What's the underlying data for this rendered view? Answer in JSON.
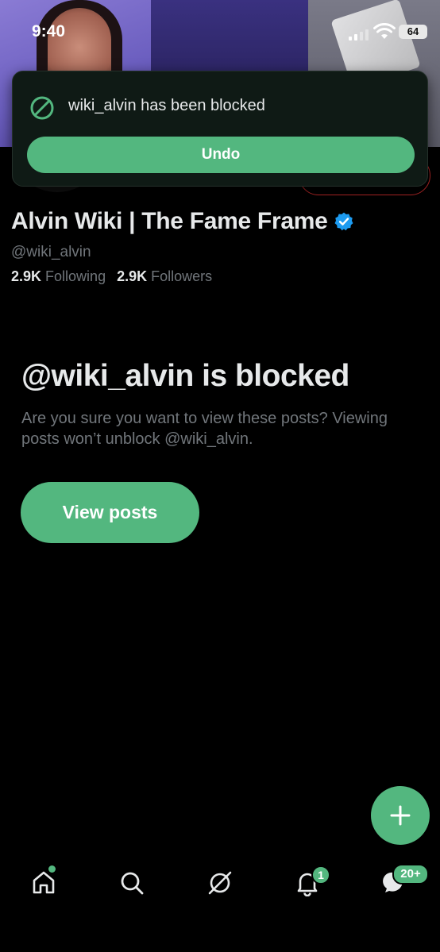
{
  "status_bar": {
    "time": "9:40",
    "battery": "64"
  },
  "toast": {
    "message": "wiki_alvin has been blocked",
    "undo_label": "Undo"
  },
  "profile": {
    "name": "Alvin Wiki | The Fame Frame",
    "handle": "@wiki_alvin",
    "following_count": "2.9K",
    "following_label": "Following",
    "followers_count": "2.9K",
    "followers_label": "Followers"
  },
  "blocked": {
    "title": "@wiki_alvin is blocked",
    "subtitle": "Are you sure you want to view these posts? Viewing posts won’t unblock @wiki_alvin.",
    "view_posts_label": "View posts"
  },
  "bottom_nav": {
    "items": [
      "home-icon",
      "search-icon",
      "grok-icon",
      "notifications-icon",
      "messages-icon"
    ],
    "notifications_badge": "1",
    "messages_badge": "20+"
  },
  "colors": {
    "accent": "#53b77f",
    "text_primary": "#e7e9ea",
    "text_secondary": "#71767b",
    "block_red": "#c62b2b"
  }
}
